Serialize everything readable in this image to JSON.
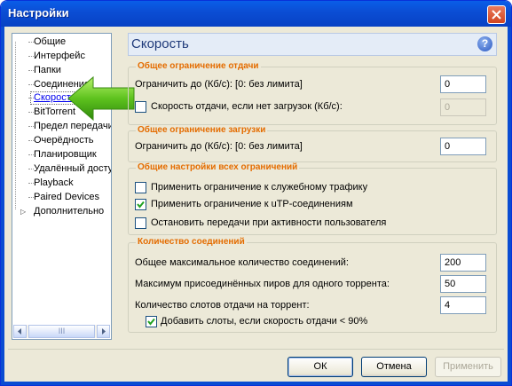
{
  "window": {
    "title": "Настройки"
  },
  "tree": {
    "items": [
      {
        "label": "Общие"
      },
      {
        "label": "Интерфейс"
      },
      {
        "label": "Папки"
      },
      {
        "label": "Соединение"
      },
      {
        "label": "Скорость",
        "selected": true
      },
      {
        "label": "BitTorrent"
      },
      {
        "label": "Предел передачи"
      },
      {
        "label": "Очерёдность"
      },
      {
        "label": "Планировщик"
      },
      {
        "label": "Удалённый доступ"
      },
      {
        "label": "Playback"
      },
      {
        "label": "Paired Devices"
      },
      {
        "label": "Дополнительно"
      }
    ],
    "scroll_thumb_glyph": "III"
  },
  "header": {
    "title": "Скорость"
  },
  "upload_group": {
    "title": "Общее ограничение отдачи",
    "limit_label": "Ограничить до (Кб/с): [0: без лимита]",
    "limit_value": "0",
    "no_download_label": "Скорость отдачи, если нет загрузок (Кб/с):",
    "no_download_value": "0",
    "no_download_checked": false
  },
  "download_group": {
    "title": "Общее ограничение загрузки",
    "limit_label": "Ограничить до (Кб/с): [0: без лимита]",
    "limit_value": "0"
  },
  "global_group": {
    "title": "Общие настройки всех ограничений",
    "options": [
      {
        "label": "Применить ограничение к служебному трафику",
        "checked": false
      },
      {
        "label": "Применить ограничение к uTP-соединениям",
        "checked": true
      },
      {
        "label": "Остановить передачи при активности пользователя",
        "checked": false
      }
    ]
  },
  "connections_group": {
    "title": "Количество соединений",
    "max_conn_label": "Общее максимальное количество соединений:",
    "max_conn_value": "200",
    "max_peers_label": "Максимум присоединённых пиров для одного торрента:",
    "max_peers_value": "50",
    "upload_slots_label": "Количество слотов отдачи на торрент:",
    "upload_slots_value": "4",
    "extra_slots_label": "Добавить слоты, если скорость отдачи < 90%",
    "extra_slots_checked": true
  },
  "buttons": {
    "ok": "ОК",
    "cancel": "Отмена",
    "apply": "Применить"
  },
  "colors": {
    "accent": "#e46c00",
    "titlebar": "#0b4ed5",
    "header_text": "#1f3a7a"
  }
}
